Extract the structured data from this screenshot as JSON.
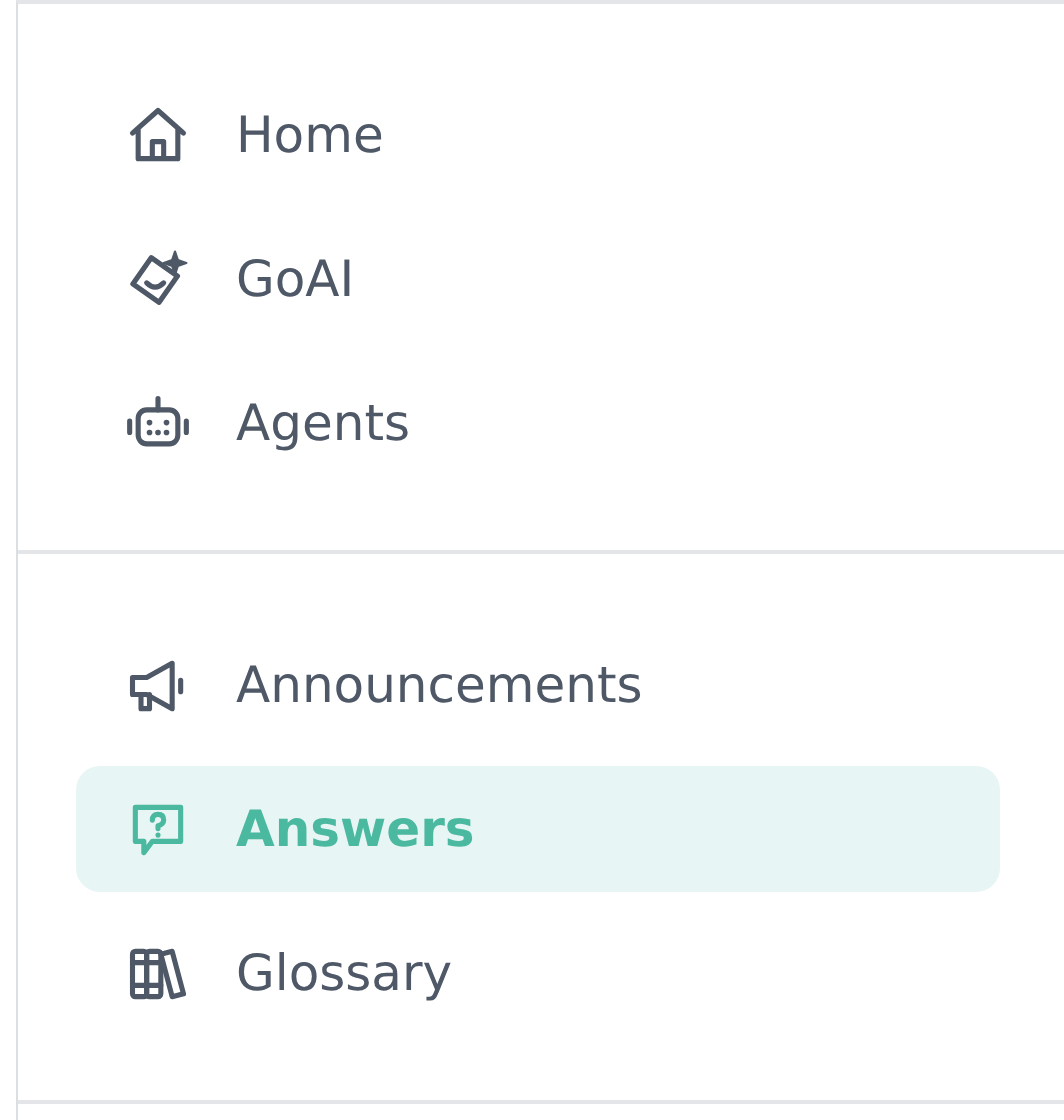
{
  "sections": [
    {
      "items": [
        {
          "kind": "home",
          "label": "Home",
          "selected": false
        },
        {
          "kind": "goai",
          "label": "GoAI",
          "selected": false
        },
        {
          "kind": "agents",
          "label": "Agents",
          "selected": false
        }
      ]
    },
    {
      "items": [
        {
          "kind": "megaphone",
          "label": "Announcements",
          "selected": false
        },
        {
          "kind": "answers",
          "label": "Answers",
          "selected": true
        },
        {
          "kind": "glossary",
          "label": "Glossary",
          "selected": false
        }
      ]
    }
  ]
}
